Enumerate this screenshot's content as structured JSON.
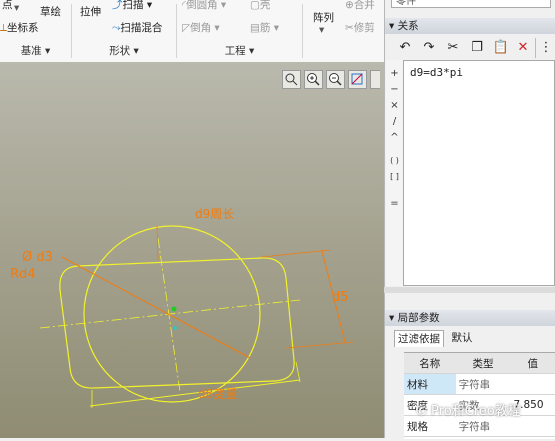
{
  "ribbon": {
    "point": "点",
    "coord_sys": "坐标系",
    "sketch": "草绘",
    "extrude": "拉伸",
    "sweep": "扫描",
    "swept_blend": "扫描混合",
    "round": "倒圆角",
    "chamfer": "倒角",
    "shell": "壳",
    "rib": "筋",
    "pattern": "阵列",
    "merge": "合并",
    "trim": "修剪",
    "group_datum": "基准",
    "group_shapes": "形状",
    "group_engineering": "工程"
  },
  "panel": {
    "top_field": "零件",
    "relations_title": "关系",
    "relation_text": "d9=d3*pi",
    "operators": [
      "+",
      "−",
      "×",
      "/",
      "^",
      "( )",
      "[ ]",
      "="
    ],
    "local_params_title": "局部参数",
    "filter_tabs": [
      "过滤依据",
      "默认"
    ],
    "table_headers": [
      "名称",
      "类型",
      "值"
    ],
    "rows": [
      {
        "name": "材料",
        "type": "字符串",
        "value": ""
      },
      {
        "name": "密度",
        "type": "实数",
        "value": "7.850"
      },
      {
        "name": "规格",
        "type": "字符串",
        "value": ""
      }
    ]
  },
  "sketch": {
    "label_d9": "d9周长",
    "label_d3": "Ø d3",
    "label_rd4": "Rd4",
    "label_d5": "d5",
    "label_d8": "d8变量"
  },
  "watermark": "Pro和Creo教程",
  "colors": {
    "sketch_yellow": "#f2f22a",
    "dim_orange": "#f07c10",
    "highlight_blue": "#cfe8f7"
  }
}
